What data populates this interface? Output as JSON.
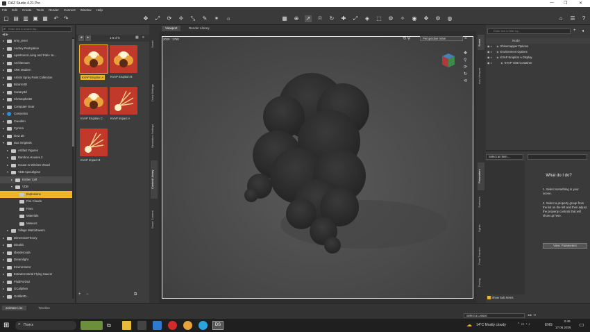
{
  "window": {
    "title": "DAZ Studio 4.21 Pro"
  },
  "menu": [
    "File",
    "Edit",
    "Create",
    "Tools",
    "Render",
    "Connect",
    "Window",
    "Help"
  ],
  "content_library": {
    "search_placeholder": "Enter text to search by...",
    "tree": [
      {
        "label": "amy_jenei",
        "indent": 1,
        "arrow": "▸"
      },
      {
        "label": "Andrey Pestryakov",
        "indent": 1,
        "arrow": "▸"
      },
      {
        "label": "Apartment Living and Patio Ja...",
        "indent": 1,
        "arrow": "▸"
      },
      {
        "label": "Architecture",
        "indent": 1,
        "arrow": "▸"
      },
      {
        "label": "ARK Modern",
        "indent": 1,
        "arrow": "▸"
      },
      {
        "label": "Artists Spray Paint Collection",
        "indent": 1,
        "arrow": "▸"
      },
      {
        "label": "Bizarre3D",
        "indent": 1,
        "arrow": "▸"
      },
      {
        "label": "Canary3d",
        "indent": 1,
        "arrow": "▸"
      },
      {
        "label": "Christophe3D",
        "indent": 1,
        "arrow": "▸"
      },
      {
        "label": "Computer Gear",
        "indent": 1,
        "arrow": "▸"
      },
      {
        "label": "Cosmetics",
        "indent": 1,
        "arrow": "▸",
        "special": true
      },
      {
        "label": "Cwodinn",
        "indent": 1,
        "arrow": "▸"
      },
      {
        "label": "Cyrona",
        "indent": 1,
        "arrow": "▸"
      },
      {
        "label": "DAZ 3D",
        "indent": 1,
        "arrow": "▸"
      },
      {
        "label": "Daz Originals",
        "indent": 1,
        "arrow": "▾"
      },
      {
        "label": "Artifact Figures",
        "indent": 2,
        "arrow": "▸"
      },
      {
        "label": "Bamboo Houses 2",
        "indent": 2,
        "arrow": "▸"
      },
      {
        "label": "House in Witches Wood",
        "indent": 2,
        "arrow": "▸"
      },
      {
        "label": "VDB Apocalypse",
        "indent": 2,
        "arrow": "▾"
      },
      {
        "label": "Ember Cell",
        "indent": 3,
        "arrow": "▸",
        "dark": true
      },
      {
        "label": "VDB",
        "indent": 3,
        "arrow": "▾"
      },
      {
        "label": "Explosions",
        "indent": 4,
        "arrow": "",
        "selected": true
      },
      {
        "label": "Fire Clouds",
        "indent": 4,
        "arrow": ""
      },
      {
        "label": "Fires",
        "indent": 4,
        "arrow": ""
      },
      {
        "label": "Materials",
        "indent": 4,
        "arrow": ""
      },
      {
        "label": "Meteors",
        "indent": 4,
        "arrow": ""
      },
      {
        "label": "Village Watchtowers",
        "indent": 2,
        "arrow": "▸"
      },
      {
        "label": "DimensionTheory",
        "indent": 1,
        "arrow": "▸"
      },
      {
        "label": "Dinalini",
        "indent": 1,
        "arrow": "▸"
      },
      {
        "label": "dlandercoda",
        "indent": 1,
        "arrow": "▸"
      },
      {
        "label": "Dreamlight",
        "indent": 1,
        "arrow": "▸"
      },
      {
        "label": "Environment",
        "indent": 1,
        "arrow": "▸"
      },
      {
        "label": "Extraterrestrial Flying Saucer",
        "indent": 1,
        "arrow": "▸"
      },
      {
        "label": "FluidForDaz",
        "indent": 1,
        "arrow": "▸"
      },
      {
        "label": "GCaliphen",
        "indent": 1,
        "arrow": "▸"
      },
      {
        "label": "Gorilla3D...",
        "indent": 1,
        "arrow": "▸"
      }
    ],
    "page_count": "1-5 of 5",
    "items": [
      {
        "label": "KVAP Eruption A",
        "selected": true,
        "kind": "cloud"
      },
      {
        "label": "KVAP Eruption B",
        "kind": "cloud"
      },
      {
        "label": "KVAP Eruption C",
        "kind": "cloud"
      },
      {
        "label": "KVAP Impact A",
        "kind": "spark"
      },
      {
        "label": "KVAP Impact B",
        "kind": "spark"
      }
    ]
  },
  "side_tabs_left": [
    "Smart",
    "Draw Settings",
    "Simulation Settings",
    "Content Library",
    "Smart Content"
  ],
  "viewport": {
    "tabs": [
      "Viewport",
      "Render Library"
    ],
    "dimensions": "2020 : 1750",
    "camera": "Perspective View"
  },
  "scene": {
    "search_placeholder": "Enter text to filter by...",
    "header": "Node",
    "nodes": [
      {
        "label": "Shinemapper Options",
        "indent": 1
      },
      {
        "label": "Environment Options",
        "indent": 1
      },
      {
        "label": "KVAP Eruption A Display",
        "indent": 1
      },
      {
        "label": "KVAP VDB Container",
        "indent": 2
      }
    ]
  },
  "side_tabs_right": [
    "Scene",
    "Aux Viewport",
    "Parameters",
    "Surfaces",
    "Lights",
    "Pose Transfer",
    "Posing"
  ],
  "parameters": {
    "select_label": "Select an item...",
    "help_title": "What do I do?",
    "steps": [
      "1. Select something in your scene.",
      "2. Select a property group from the list on the left and then adjust the property controls that will show up here."
    ],
    "button": "View: Parameters",
    "show_sub_items": "Show Sub Items"
  },
  "bottom_tabs": [
    "aniMate Lite",
    "Timeline"
  ],
  "lesson_select": "Select a Lesson",
  "taskbar": {
    "search": "Поиск",
    "weather": "14°C  Mostly cloudy",
    "lang": "ENG",
    "time": "3:45",
    "date": "17.06.2025"
  },
  "colors": {
    "selection": "#f0b429",
    "thumb_bg": "#c0392b",
    "accent": "#f0b429"
  }
}
